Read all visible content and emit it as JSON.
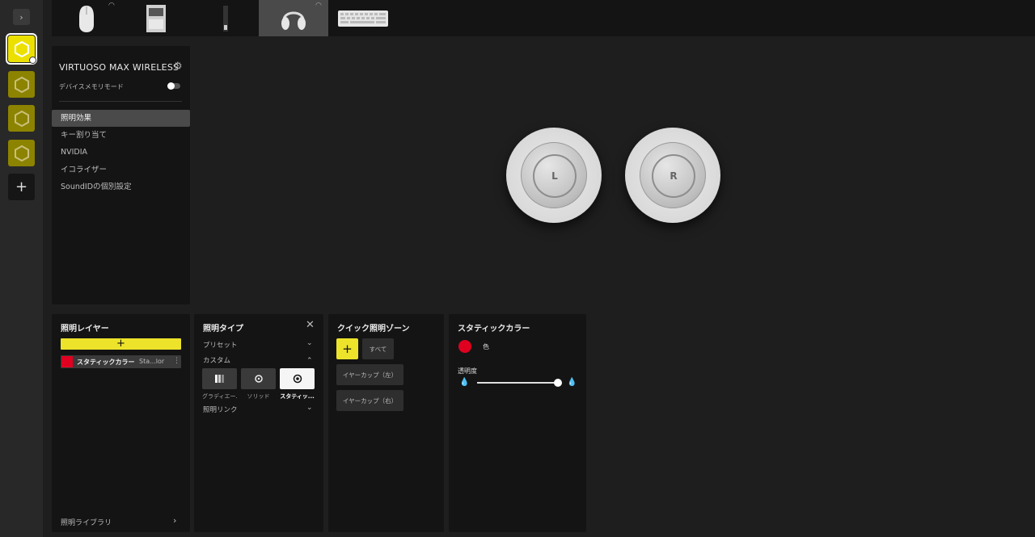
{
  "rail": {
    "toggle_glyph": "›",
    "add_glyph": "+",
    "profiles": [
      "profile-active",
      "profile-2",
      "profile-3",
      "profile-4"
    ]
  },
  "devices": [
    {
      "name": "mouse-icon",
      "wireless": true
    },
    {
      "name": "dongle-icon",
      "wireless": false
    },
    {
      "name": "usb-receiver-icon",
      "wireless": false
    },
    {
      "name": "headset-icon",
      "wireless": true,
      "active": true
    },
    {
      "name": "keyboard-icon",
      "wireless": false
    }
  ],
  "sidebar": {
    "device_title": "VIRTUOSO MAX WIRELESS",
    "memory_mode_label": "デバイスメモリモード",
    "memory_mode_on": false,
    "items": [
      {
        "label": "照明効果",
        "active": true
      },
      {
        "label": "キー割り当て"
      },
      {
        "label": "NVIDIA"
      },
      {
        "label": "イコライザー"
      },
      {
        "label": "SoundIDの個別設定"
      }
    ]
  },
  "preview": {
    "left_label": "L",
    "right_label": "R"
  },
  "layers_panel": {
    "title": "照明レイヤー",
    "add_glyph": "+",
    "layer": {
      "name": "スタティックカラー",
      "sub": "Sta...lor",
      "color": "#e00020"
    },
    "library_label": "照明ライブラリ",
    "library_arrow": "›"
  },
  "type_panel": {
    "title": "照明タイプ",
    "close_glyph": "✕",
    "preset_label": "プリセット",
    "custom_label": "カスタム",
    "link_label": "照明リンク",
    "types": [
      {
        "caption": "グラディエー...",
        "icon": "gradient-icon"
      },
      {
        "caption": "ソリッド",
        "icon": "solid-icon"
      },
      {
        "caption": "スタティッ...",
        "icon": "static-icon",
        "selected": true
      }
    ]
  },
  "zones_panel": {
    "title": "クイック照明ゾーン",
    "add_glyph": "+",
    "all_label": "すべて",
    "left_cup_label": "イヤーカップ（左）",
    "right_cup_label": "イヤーカップ（右）"
  },
  "color_panel": {
    "title": "スタティックカラー",
    "color_label": "色",
    "opacity_label": "透明度",
    "current_color": "#e00020",
    "opacity_value": 1.0
  }
}
